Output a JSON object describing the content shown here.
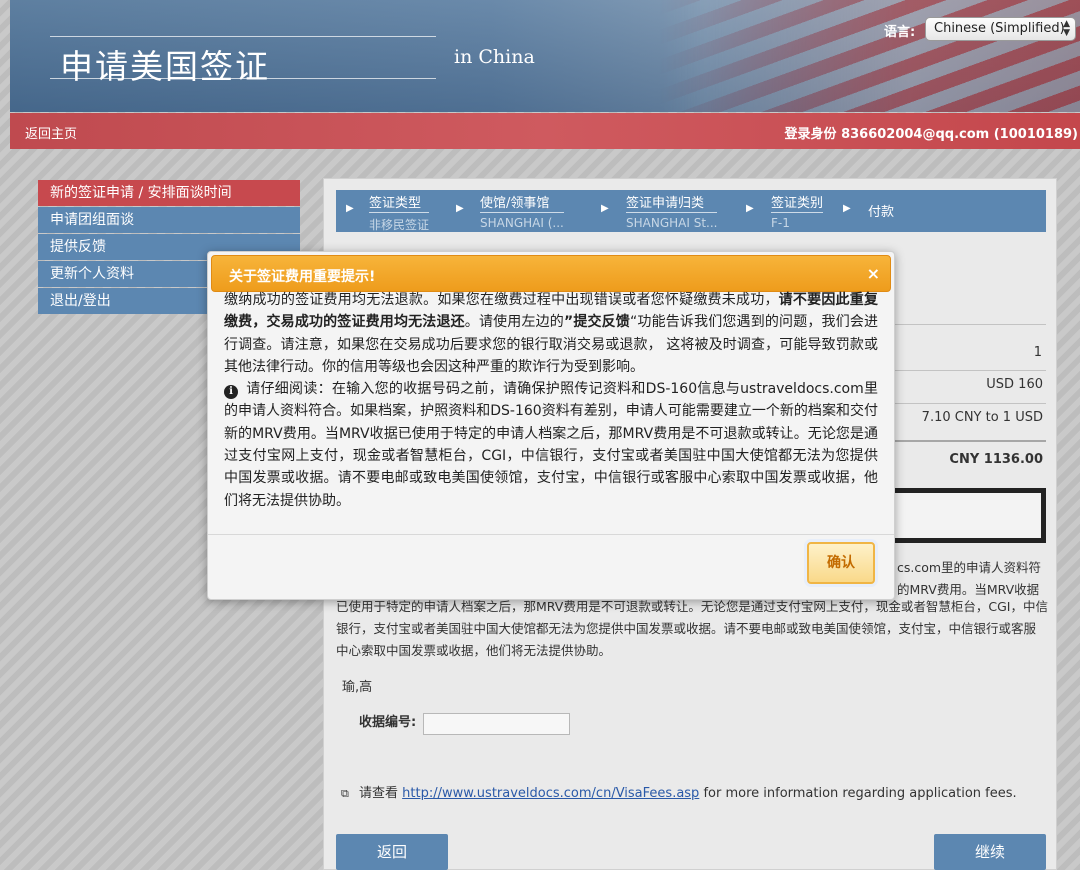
{
  "header": {
    "title": "申请美国签证",
    "subtitle": "in  China",
    "language_label": "语言:",
    "language_value": "Chinese (Simplified)"
  },
  "topbar": {
    "home": "返回主页",
    "login_info": "登录身份  836602004@qq.com (10010189)"
  },
  "sidebar": {
    "items": [
      {
        "label": "新的签证申请 / 安排面谈时间",
        "active": true
      },
      {
        "label": "申请团组面谈",
        "active": false
      },
      {
        "label": "提供反馈",
        "active": false
      },
      {
        "label": "更新个人资料",
        "active": false
      },
      {
        "label": "退出/登出",
        "active": false
      }
    ]
  },
  "breadcrumb": [
    {
      "title": "签证类型",
      "value": "非移民签证"
    },
    {
      "title": "使馆/领事馆",
      "value": "SHANGHAI (..."
    },
    {
      "title": "签证申请归类",
      "value": "SHANGHAI St..."
    },
    {
      "title": "签证类别",
      "value": "F-1"
    },
    {
      "title": "付款",
      "value": ""
    }
  ],
  "fee_table": {
    "quantity": "1",
    "fee_usd": "USD 160",
    "exchange_rate": "7.10 CNY to 1 USD",
    "total": "CNY 1136.00"
  },
  "body": {
    "partial_line1": "cs.com里的申请人资料符",
    "partial_line2": "的MRV费用。当MRV收据",
    "paragraph": "已使用于特定的申请人档案之后，那MRV费用是不可退款或转让。无论您是通过支付宝网上支付，现金或者智慧柜台，CGI，中信银行，支付宝或者美国驻中国大使馆都无法为您提供中国发票或收据。请不要电邮或致电美国使领馆，支付宝，中信银行或客服中心索取中国发票或收据，他们将无法提供协助。",
    "name": "瑜,高",
    "receipt_label": "收据编号:",
    "receipt_value": "",
    "more_info_prefix": "请查看 ",
    "more_info_link": "http://www.ustraveldocs.com/cn/VisaFees.asp",
    "more_info_suffix": " for more information regarding application fees.",
    "back_button": "返回",
    "continue_button": "继续"
  },
  "modal": {
    "title": "关于签证费用重要提示!",
    "close": "×",
    "p1_a": "缴纳成功的签证费用均无法退款。如果您在缴费过程中出现错误或者您怀疑缴费未成功，",
    "p1_b": "请不要因此重复缴费，交易成功的签证费用均无法退还",
    "p1_c": "。请使用左边的",
    "p1_d": "”提交反馈",
    "p1_e": "“功能告诉我们您遇到的问题，我们会进行调查。请注意，如果您在交易成功后要求您的银行取消交易或退款， 这将被及时调查，可能导致罚款或其他法律行动。你的信用等级也会因这种严重的欺诈行为受到影响。",
    "info_icon": "i",
    "p2": "请仔细阅读：在输入您的收据号码之前，请确保护照传记资料和DS-160信息与ustraveldocs.com里的申请人资料符合。如果档案，护照资料和DS-160资料有差别，申请人可能需要建立一个新的档案和交付新的MRV费用。当MRV收据已使用于特定的申请人档案之后，那MRV费用是不可退款或转让。无论您是通过支付宝网上支付，现金或者智慧柜台，CGI，中信银行，支付宝或者美国驻中国大使馆都无法为您提供中国发票或收据。请不要电邮或致电美国使领馆，支付宝，中信银行或客服中心索取中国发票或收据，他们将无法提供协助。",
    "ok_button": "确认"
  },
  "colors": {
    "nav_blue": "#5c87b1",
    "accent_red": "#c7494e",
    "modal_orange": "#f0a12a"
  }
}
